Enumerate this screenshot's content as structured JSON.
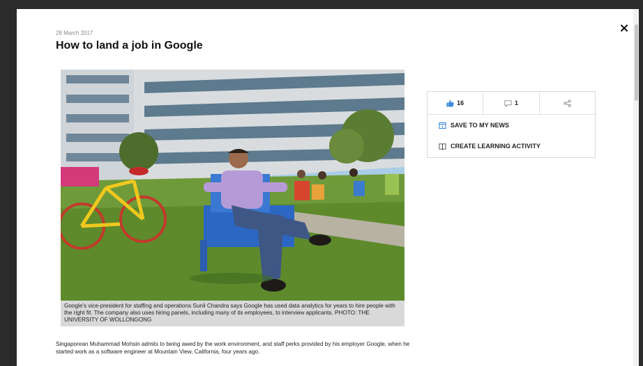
{
  "article": {
    "date": "28 March 2017",
    "title": "How to land a job in Google",
    "caption": "Google's vice-president for staffing and operations Sunil Chandra says Google has used data analytics for years to hire people with the right fit. The company also uses hiring panels, including many of its employees, to interview applicants. PHOTO: THE UNIVERSITY OF WOLLONGONG",
    "body": "Singaporean Muhammad Mohsin admits to being awed by the work environment, and staff perks provided by his employer Google, when he started work as a software engineer at Mountain View, California, four years ago."
  },
  "panel": {
    "likes": "16",
    "comments": "1",
    "save_label": "SAVE TO MY NEWS",
    "learning_label": "CREATE LEARNING ACTIVITY"
  },
  "icons": {
    "close": "×",
    "like": "thumbs-up-icon",
    "comment": "comment-icon",
    "share": "share-icon",
    "save": "bookmark-icon",
    "learning": "book-icon"
  },
  "colors": {
    "overlay": "#2b2b2b",
    "like_icon": "#3b8ad9",
    "save_icon": "#3b8ad9"
  }
}
